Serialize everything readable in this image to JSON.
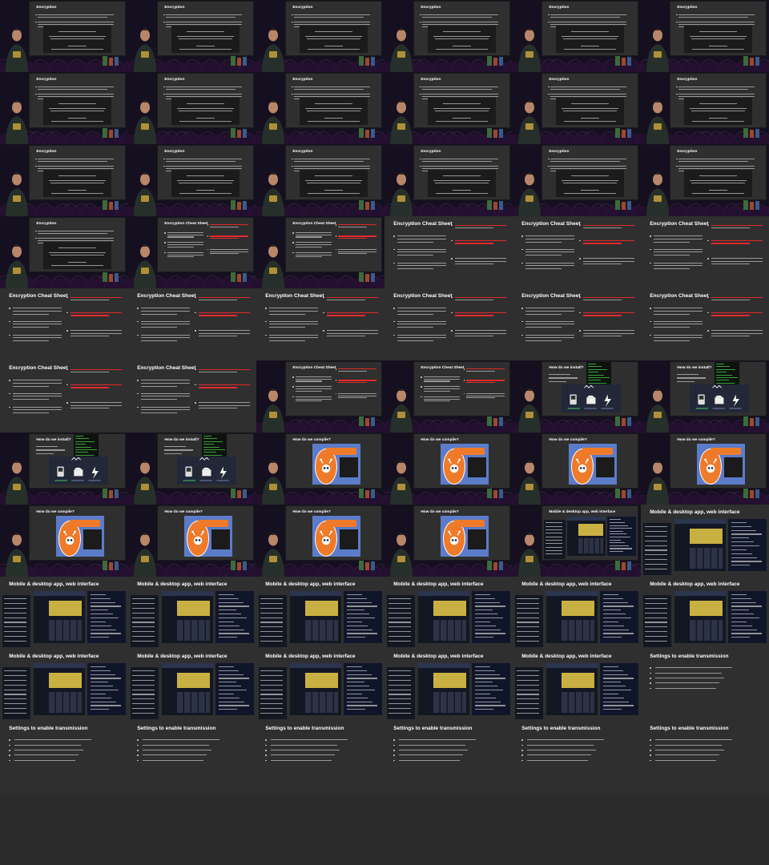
{
  "grid": {
    "columns": 6,
    "rows": 11
  },
  "colors": {
    "background": "#2b2b2b",
    "slide": "#2f2f2f",
    "stage": "#15101f",
    "highlight": "#e02a2a",
    "platformio_orange": "#ef7b2a",
    "platformio_blue": "#5c7cc9"
  },
  "titles": {
    "encryption": "Encryption",
    "cheat_sheet": "Encryption Cheat Sheet",
    "install": "How do we install?",
    "compile": "How do we compile?",
    "apps": "Mobile & desktop app, web interface",
    "settings": "Settings to enable transmission"
  },
  "frames": [
    {
      "slide": "encryption",
      "layout": "pip"
    },
    {
      "slide": "encryption",
      "layout": "pip"
    },
    {
      "slide": "encryption",
      "layout": "pip"
    },
    {
      "slide": "encryption",
      "layout": "pip"
    },
    {
      "slide": "encryption",
      "layout": "pip"
    },
    {
      "slide": "encryption",
      "layout": "pip"
    },
    {
      "slide": "encryption",
      "layout": "pip"
    },
    {
      "slide": "encryption",
      "layout": "pip"
    },
    {
      "slide": "encryption",
      "layout": "pip"
    },
    {
      "slide": "encryption",
      "layout": "pip"
    },
    {
      "slide": "encryption",
      "layout": "pip"
    },
    {
      "slide": "encryption",
      "layout": "pip"
    },
    {
      "slide": "encryption",
      "layout": "pip"
    },
    {
      "slide": "encryption",
      "layout": "pip"
    },
    {
      "slide": "encryption",
      "layout": "pip"
    },
    {
      "slide": "encryption",
      "layout": "pip"
    },
    {
      "slide": "encryption",
      "layout": "pip"
    },
    {
      "slide": "encryption",
      "layout": "pip"
    },
    {
      "slide": "encryption",
      "layout": "pip"
    },
    {
      "slide": "cheat_sheet",
      "layout": "pip"
    },
    {
      "slide": "cheat_sheet",
      "layout": "pip"
    },
    {
      "slide": "cheat_sheet",
      "layout": "full"
    },
    {
      "slide": "cheat_sheet",
      "layout": "full"
    },
    {
      "slide": "cheat_sheet",
      "layout": "full"
    },
    {
      "slide": "cheat_sheet",
      "layout": "full"
    },
    {
      "slide": "cheat_sheet",
      "layout": "full"
    },
    {
      "slide": "cheat_sheet",
      "layout": "full"
    },
    {
      "slide": "cheat_sheet",
      "layout": "full"
    },
    {
      "slide": "cheat_sheet",
      "layout": "full"
    },
    {
      "slide": "cheat_sheet",
      "layout": "full"
    },
    {
      "slide": "cheat_sheet",
      "layout": "full"
    },
    {
      "slide": "cheat_sheet",
      "layout": "full"
    },
    {
      "slide": "cheat_sheet",
      "layout": "pip"
    },
    {
      "slide": "cheat_sheet",
      "layout": "pip"
    },
    {
      "slide": "install",
      "layout": "pip"
    },
    {
      "slide": "install",
      "layout": "pip"
    },
    {
      "slide": "install",
      "layout": "pip"
    },
    {
      "slide": "install",
      "layout": "pip"
    },
    {
      "slide": "compile",
      "layout": "pip"
    },
    {
      "slide": "compile",
      "layout": "pip"
    },
    {
      "slide": "compile",
      "layout": "pip"
    },
    {
      "slide": "compile",
      "layout": "pip"
    },
    {
      "slide": "compile",
      "layout": "pip"
    },
    {
      "slide": "compile",
      "layout": "pip"
    },
    {
      "slide": "compile",
      "layout": "pip"
    },
    {
      "slide": "compile",
      "layout": "pip"
    },
    {
      "slide": "apps",
      "layout": "pip"
    },
    {
      "slide": "apps",
      "layout": "full"
    },
    {
      "slide": "apps",
      "layout": "full"
    },
    {
      "slide": "apps",
      "layout": "full"
    },
    {
      "slide": "apps",
      "layout": "full"
    },
    {
      "slide": "apps",
      "layout": "full"
    },
    {
      "slide": "apps",
      "layout": "full"
    },
    {
      "slide": "apps",
      "layout": "full"
    },
    {
      "slide": "apps",
      "layout": "full"
    },
    {
      "slide": "apps",
      "layout": "full"
    },
    {
      "slide": "apps",
      "layout": "full"
    },
    {
      "slide": "apps",
      "layout": "full"
    },
    {
      "slide": "apps",
      "layout": "full"
    },
    {
      "slide": "settings",
      "layout": "full"
    },
    {
      "slide": "settings",
      "layout": "full"
    },
    {
      "slide": "settings",
      "layout": "full"
    },
    {
      "slide": "settings",
      "layout": "full"
    },
    {
      "slide": "settings",
      "layout": "full"
    },
    {
      "slide": "settings",
      "layout": "full"
    },
    {
      "slide": "settings",
      "layout": "full"
    },
    {
      "slide": "none",
      "layout": "empty"
    },
    {
      "slide": "none",
      "layout": "empty"
    },
    {
      "slide": "none",
      "layout": "empty"
    },
    {
      "slide": "none",
      "layout": "empty"
    },
    {
      "slide": "none",
      "layout": "empty"
    },
    {
      "slide": "none",
      "layout": "empty"
    }
  ]
}
